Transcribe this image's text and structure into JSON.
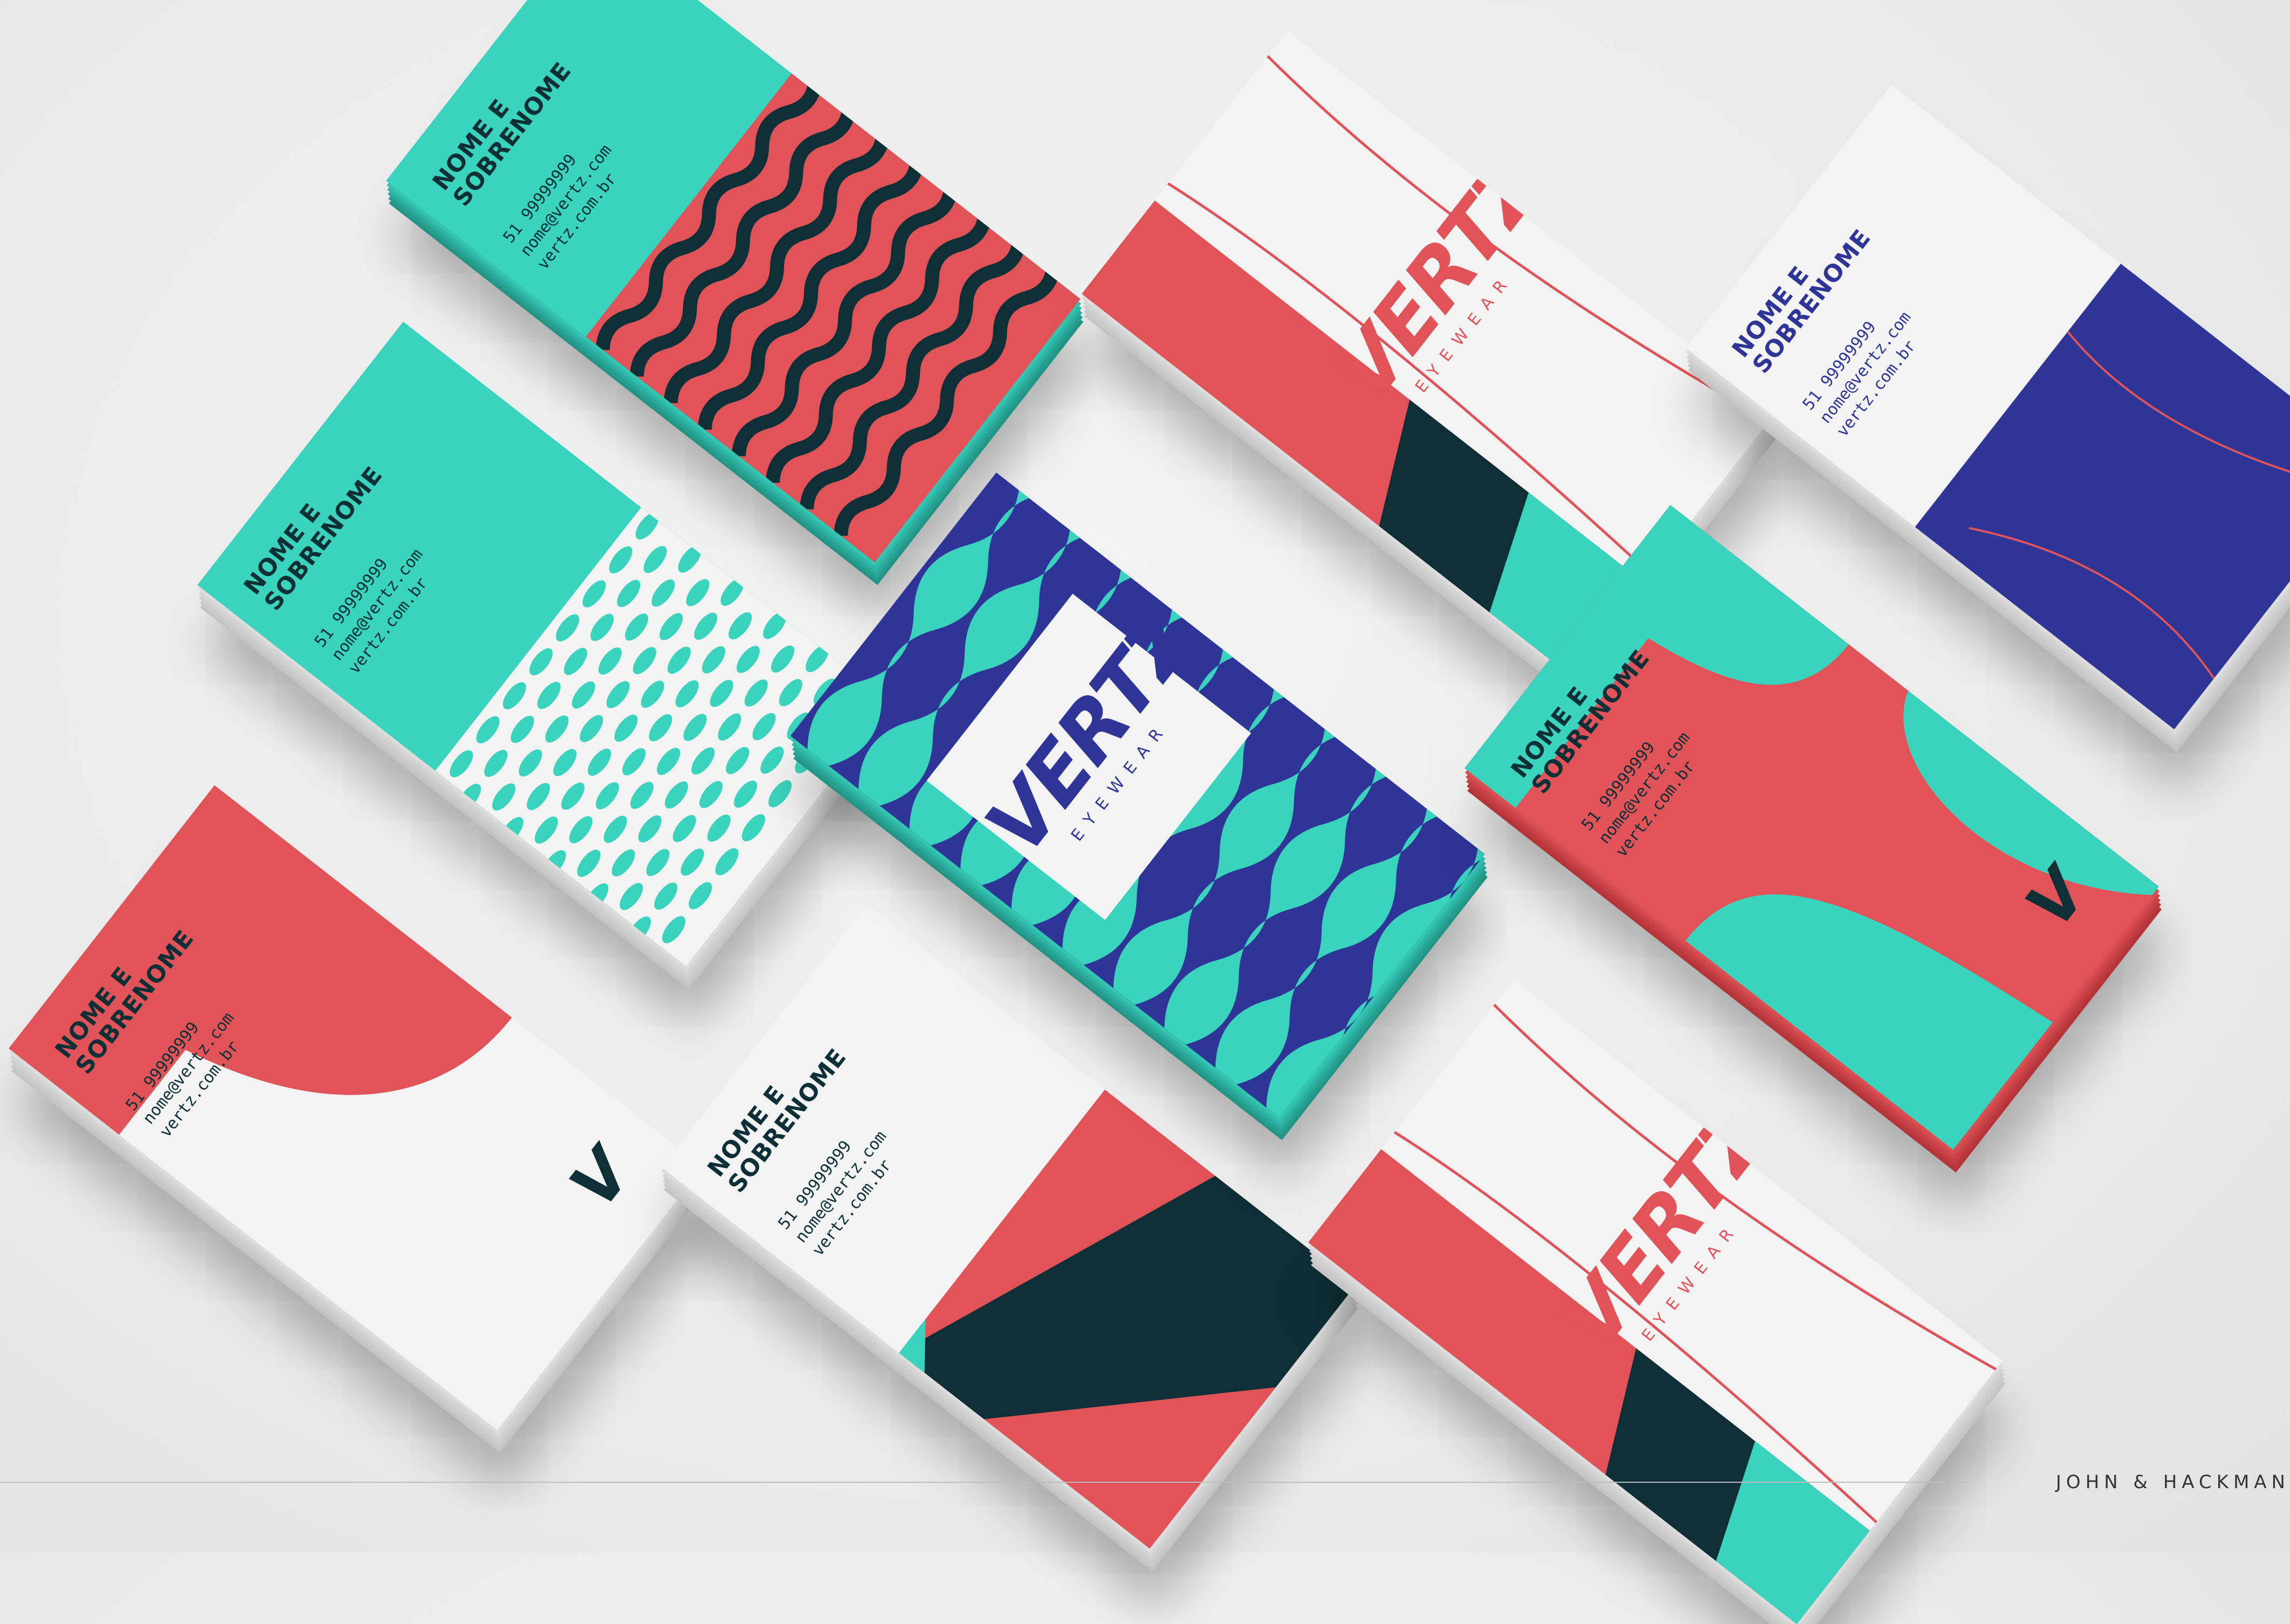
{
  "scene": {
    "description_colors": {
      "teal": "#3ad3bd",
      "red": "#e05358",
      "navy": "#2e3596",
      "dark": "#0e2f36",
      "white": "#f3f3f3"
    }
  },
  "card": {
    "name": "NOME E SOBRENOME",
    "phone_a": "51 99999999",
    "phone_b": "51 99999999",
    "phone_c": "51 99999999",
    "phone_d": "51 99999999",
    "phone_e": "51 99999999",
    "phone_f": "51 99999999",
    "email": "nome@vertz.com",
    "email_alt": "nome@vertz.com",
    "site": "vertz.com.br"
  },
  "logo": {
    "wordmark": "VERTZ",
    "tagline": "EYEWEAR",
    "monogram": "V"
  },
  "credit": {
    "label": "JOHN & HACKMAN"
  }
}
